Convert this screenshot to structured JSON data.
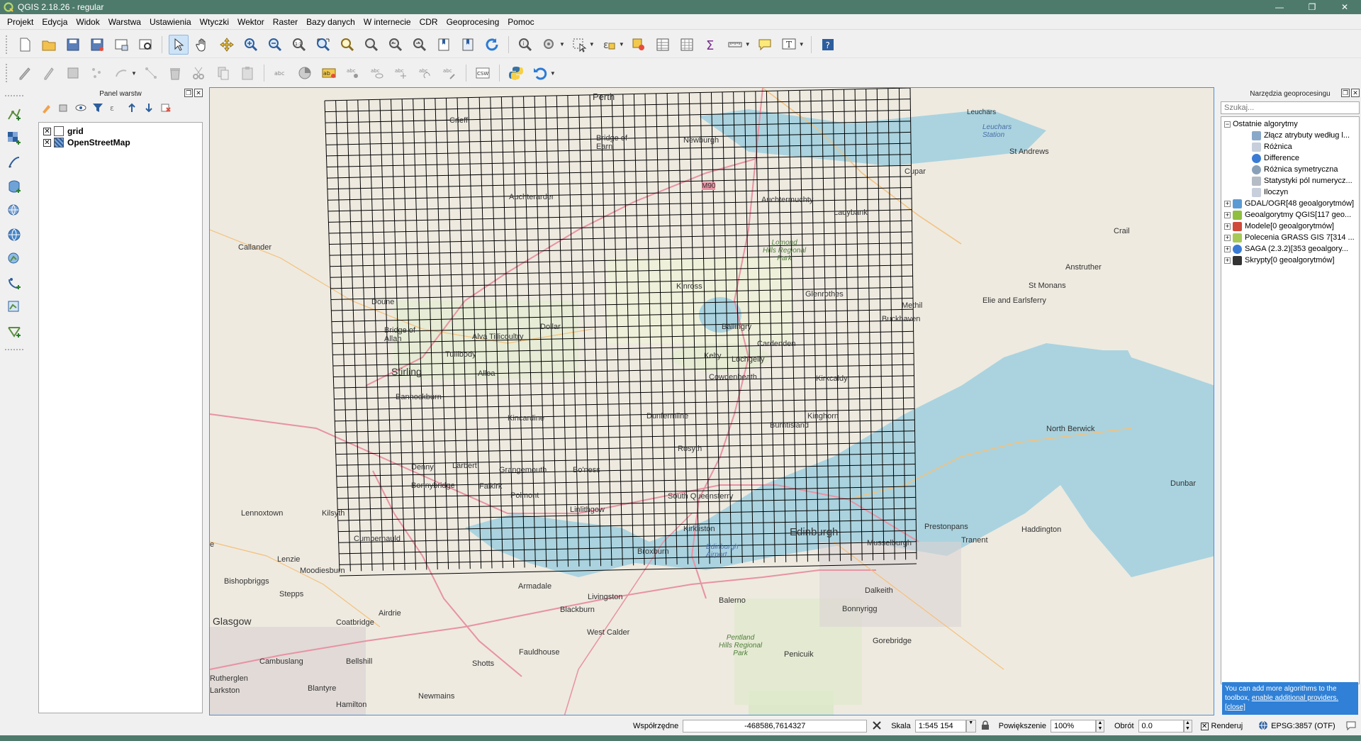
{
  "window": {
    "title": "QGIS 2.18.26 - regular",
    "buttons": [
      "—",
      "❐",
      "✕"
    ]
  },
  "menu": [
    "Projekt",
    "Edycja",
    "Widok",
    "Warstwa",
    "Ustawienia",
    "Wtyczki",
    "Wektor",
    "Raster",
    "Bazy danych",
    "W internecie",
    "CDR",
    "Geoprocesing",
    "Pomoc"
  ],
  "layers_panel": {
    "title": "Panel warstw",
    "layers": [
      {
        "name": "grid",
        "checked": "✕"
      },
      {
        "name": "OpenStreetMap",
        "checked": "✕"
      }
    ]
  },
  "map": {
    "labels": {
      "perth": "Perth",
      "crieff": "Crieff",
      "bridge_of_earn": "Bridge of\nEarn",
      "newburgh": "Newburgh",
      "leuchars": "Leuchars",
      "leuchars_station": "Leuchars\nStation",
      "st_andrews": "St Andrews",
      "cupar": "Cupar",
      "m90": "M90",
      "auchterarder": "Auchterarder",
      "auchtermuchty": "Auchtermuchty",
      "ladybank": "Ladybank",
      "lomond": "Lomond\nHills Regional\nPark",
      "crail": "Crail",
      "callander": "Callander",
      "anstruther": "Anstruther",
      "st_monans": "St Monans",
      "kinross": "Kinross",
      "glenrothes": "Glenrothes",
      "elie": "Elie and Earlsferry",
      "methil": "Methil",
      "buckhaven": "Buckhaven",
      "doune": "Doune",
      "bridge_of_allan": "Bridge of\nAllan",
      "alva": "Alva",
      "tillicoultry": "Tillicoultry",
      "dollar": "Dollar",
      "ballingry": "Ballingry",
      "tullibody": "Tullibody",
      "cardenden": "Cardenden",
      "kelty": "Kelty",
      "lochgelly": "Lochgelly",
      "stirling": "Stirling",
      "alloa": "Alloa",
      "cowdenbeath": "Cowdenbeath",
      "kirkcaldy": "Kirkcaldy",
      "bannockburn": "Bannockburn",
      "kincardine": "Kincardine",
      "dunfermline": "Dunfermline",
      "kinghorn": "Kinghorn",
      "burntisland": "Burntisland",
      "north_berwick": "North Berwick",
      "rosyth": "Rosyth",
      "denny": "Denny",
      "larbert": "Larbert",
      "grangemouth": "Grangemouth",
      "bonnybridge": "Bonnybridge",
      "falkirk": "Falkirk",
      "bo_ness": "Bo'ness",
      "polmont": "Polmont",
      "south_queensferry": "South Queensferry",
      "dunbar": "Dunbar",
      "lennoxtown": "Lennoxtown",
      "kilsyth": "Kilsyth",
      "cumbernauld": "Cumbernauld",
      "linlithgow": "Linlithgow",
      "kirkliston": "Kirkliston",
      "edinburgh": "Edinburgh",
      "prestonpans": "Prestonpans",
      "tranent": "Tranent",
      "haddington": "Haddington",
      "edinburgh_airport": "Edinburgh\nAirport",
      "lenzie": "Lenzie",
      "moodiesburn": "Moodiesburn",
      "broxburn": "Broxburn",
      "musselburgh": "Musselburgh",
      "bishopbriggs": "Bishopbriggs",
      "stepps": "Stepps",
      "armadale": "Armadale",
      "livingston": "Livingston",
      "balerno": "Balerno",
      "dalkeith": "Dalkeith",
      "glasgow": "Glasgow",
      "airdrie": "Airdrie",
      "coatbridge": "Coatbridge",
      "blackburn": "Blackburn",
      "bonnyrigg": "Bonnyrigg",
      "west_calder": "West Calder",
      "pentland": "Pentland\nHills Regional\nPark",
      "gorebridge": "Gorebridge",
      "cambuslang": "Cambuslang",
      "bellshill": "Bellshill",
      "fauldhouse": "Fauldhouse",
      "shotts": "Shotts",
      "penicuik": "Penicuik",
      "rutherglen": "Rutherglen",
      "blantyre": "Blantyre",
      "carluke": "Larkston",
      "newmains": "Newmains",
      "hamilton": "Hamilton",
      "e": "e"
    },
    "grid": {
      "cols": 53,
      "rows": 43
    }
  },
  "geoproc_panel": {
    "title": "Narzędzia geoprocesingu",
    "search_placeholder": "Szukaj...",
    "recent_label": "Ostatnie algorytmy",
    "recent": [
      "Złącz atrybuty według l...",
      "Różnica",
      "Difference",
      "Różnica symetryczna",
      "Statystyki pól numerycz...",
      "Iloczyn"
    ],
    "providers": [
      "GDAL/OGR[48 geoalgorytmów]",
      "Geoalgorytmy QGIS[117 geo...",
      "Modele[0 geoalgorytmów]",
      "Polecenia GRASS GIS 7[314 ...",
      "SAGA (2.3.2)[353 geoalgory...",
      "Skrypty[0 geoalgorytmów]"
    ],
    "note_text": "You can add more algorithms to the toolbox,",
    "note_link": "enable additional providers.",
    "note_close": "[close]"
  },
  "statusbar": {
    "coord_label": "Współrzędne",
    "coord_value": "-468586,7614327",
    "scale_label": "Skala",
    "scale_value": "1:545 154",
    "magnifier_label": "Powiększenie",
    "magnifier_value": "100%",
    "rotation_label": "Obrót",
    "rotation_value": "0.0",
    "render_label": "Renderuj",
    "crs": "EPSG:3857 (OTF)"
  },
  "colors": {
    "titlebar": "#4e7a6c",
    "map_land": "#eeeae0",
    "map_water": "#aad3df",
    "grid_line": "#000000",
    "motorway": "#e892a2",
    "selection": "#4a90d9"
  }
}
